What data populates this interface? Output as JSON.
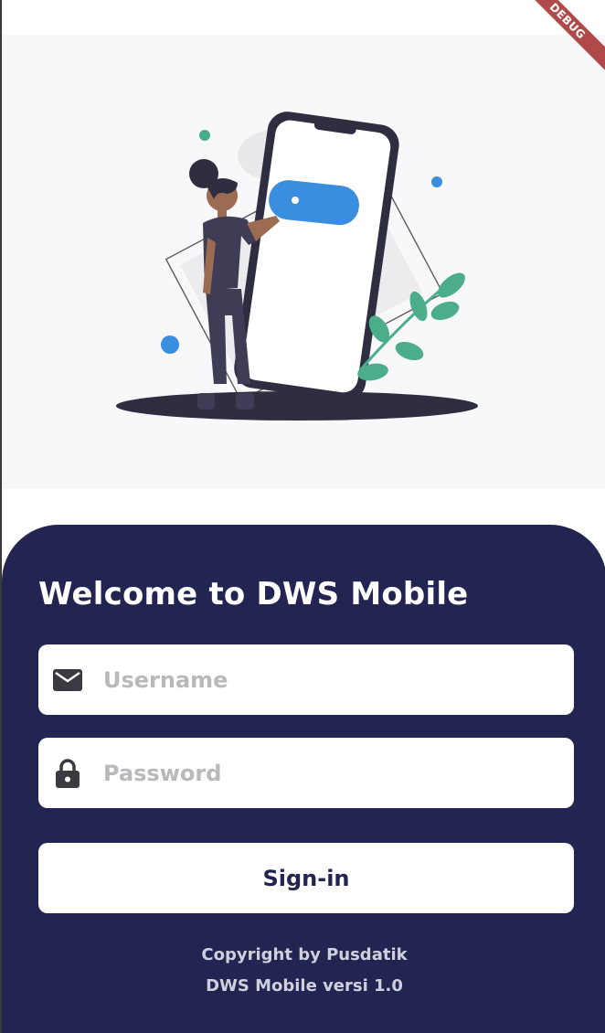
{
  "debug_banner": "DEBUG",
  "login": {
    "welcome_title": "Welcome to DWS Mobile",
    "username": {
      "placeholder": "Username",
      "value": "",
      "icon": "mail-icon"
    },
    "password": {
      "placeholder": "Password",
      "value": "",
      "icon": "lock-icon"
    },
    "signin_label": "Sign-in"
  },
  "footer": {
    "copyright": "Copyright by Pusdatik",
    "version": "DWS Mobile versi 1.0"
  },
  "colors": {
    "panel": "#222452",
    "accent_blue": "#3a8ee0",
    "leaf_green": "#4cad8b",
    "hero_bg": "#f8f8fa"
  }
}
